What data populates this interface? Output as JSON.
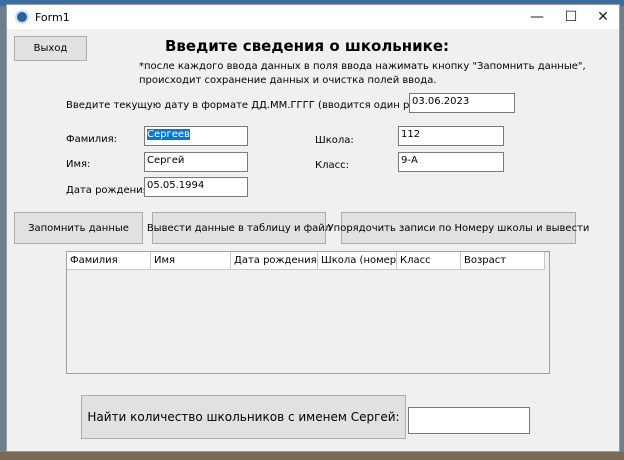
{
  "window": {
    "title": "Form1",
    "minimize": "—",
    "maximize": "☐",
    "close": "✕"
  },
  "exit_button": "Выход",
  "heading": "Введите сведения о школьнике:",
  "note_line1": "*после каждого ввода данных в поля ввода нажимать кнопку \"Запомнить данные\",",
  "note_line2": "происходит сохранение данных и очистка полей ввода.",
  "current_date": {
    "label": "Введите текущую дату в формате ДД.ММ.ГГГГ (вводится один раз в начале):",
    "value": "03.06.2023"
  },
  "fields": {
    "surname": {
      "label": "Фамилия:",
      "value": "Сергеев"
    },
    "name": {
      "label": "Имя:",
      "value": "Сергей"
    },
    "birthdate": {
      "label": "Дата рождения:",
      "value": "05.05.1994"
    },
    "school": {
      "label": "Школа:",
      "value": "112"
    },
    "class": {
      "label": "Класс:",
      "value": "9-А"
    }
  },
  "buttons": {
    "save": "Запомнить данные",
    "output": "Вывести данные в таблицу и файл",
    "sort": "Упорядочить записи по Номеру школы и вывести"
  },
  "table": {
    "columns": [
      "Фамилия",
      "Имя",
      "Дата рождения",
      "Школа (номер)",
      "Класс",
      "Возраст"
    ],
    "rows": []
  },
  "find": {
    "button": "Найти количество школьников с именем Сергей:",
    "value": ""
  }
}
